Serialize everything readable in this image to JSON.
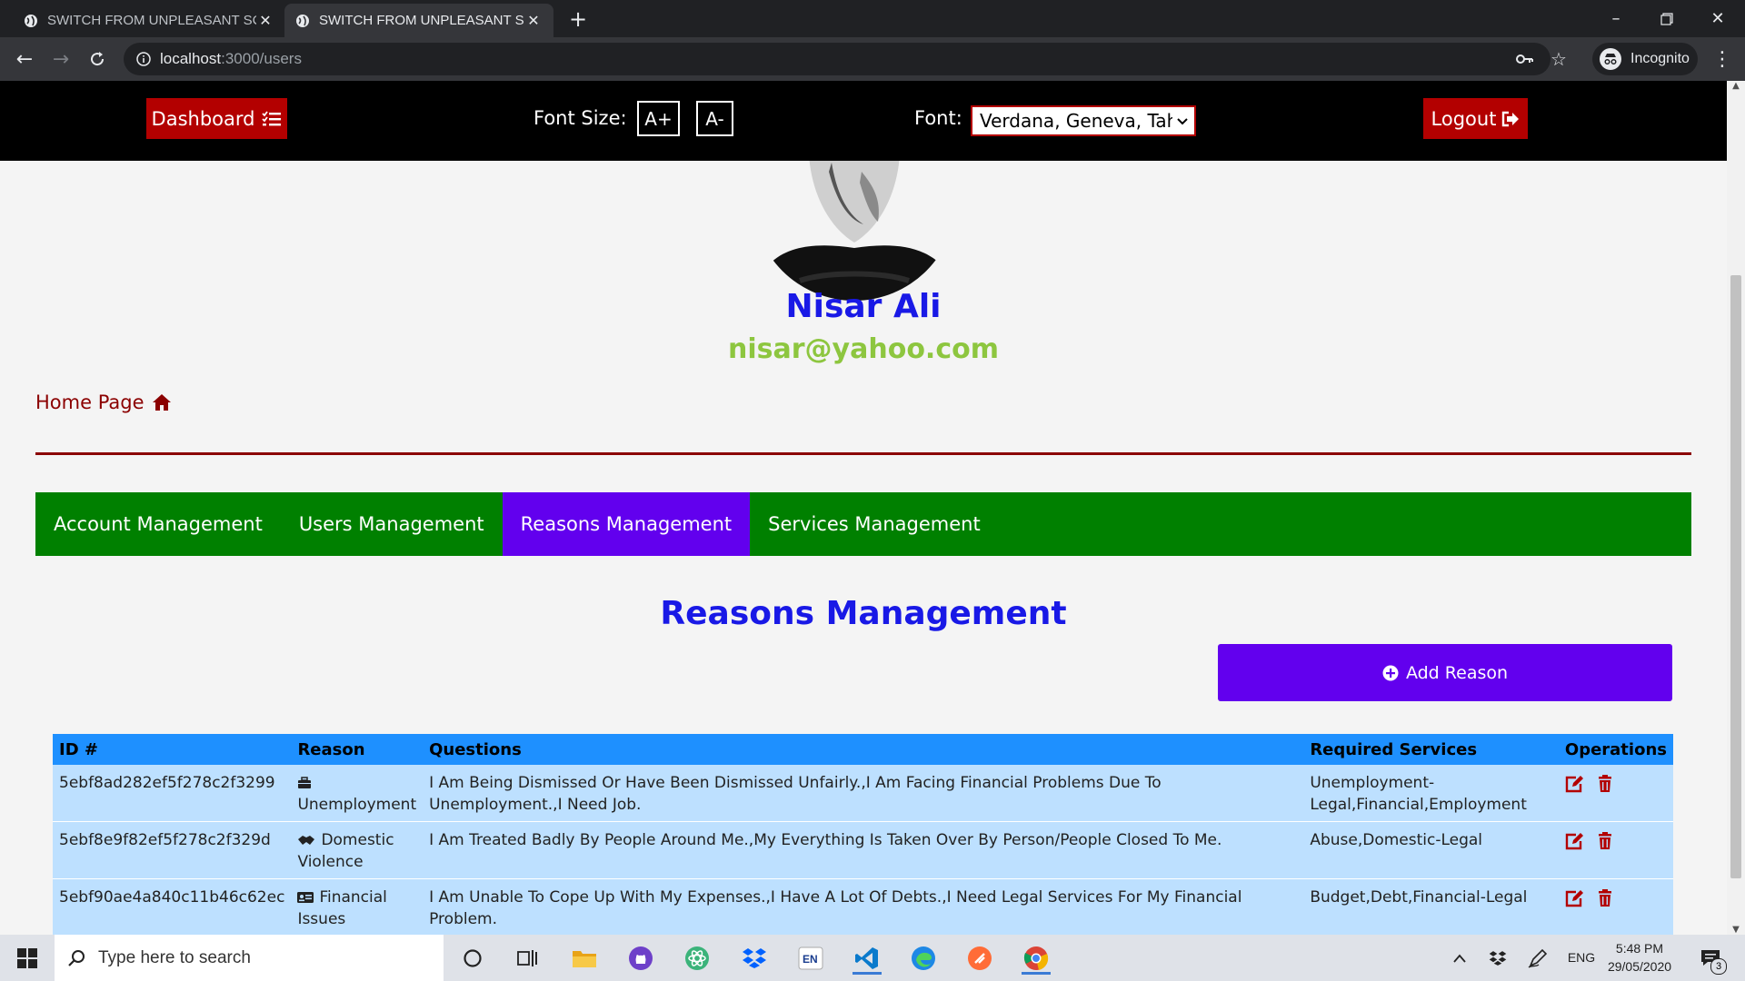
{
  "browser": {
    "tabs": [
      {
        "title": "SWITCH FROM UNPLEASANT SCENARIO",
        "active": false
      },
      {
        "title": "SWITCH FROM UNPLEASANT SCENARIO",
        "active": true
      }
    ],
    "url_host": "localhost",
    "url_path": ":3000/users",
    "profile_label": "Incognito"
  },
  "header": {
    "dashboard_label": "Dashboard",
    "font_size_label": "Font Size:",
    "increase_label": "A+",
    "decrease_label": "A-",
    "font_label": "Font:",
    "font_value": "Verdana, Geneva, Tahoma, sans-serif",
    "logout_label": "Logout"
  },
  "profile": {
    "name": "Nisar Ali",
    "email": "nisar@yahoo.com"
  },
  "home_link": "Home Page",
  "mgmt_nav": [
    {
      "label": "Account Management",
      "active": false
    },
    {
      "label": "Users Management",
      "active": false
    },
    {
      "label": "Reasons Management",
      "active": true
    },
    {
      "label": "Services Management",
      "active": false
    }
  ],
  "section_title": "Reasons Management",
  "add_button_label": "Add Reason",
  "table": {
    "columns": [
      "ID #",
      "Reason",
      "Questions",
      "Required Services",
      "Operations"
    ],
    "rows": [
      {
        "id": "5ebf8ad282ef5f278c2f3299",
        "reason": "Unemployment",
        "reason_icon": "briefcase-icon",
        "questions": "I Am Being Dismissed Or Have Been Dismissed Unfairly.,I Am Facing Financial Problems Due To Unemployment.,I Need Job.",
        "services": "Unemployment-Legal,Financial,Employment"
      },
      {
        "id": "5ebf8e9f82ef5f278c2f329d",
        "reason": "Domestic Violence",
        "reason_icon": "handshake-icon",
        "questions": "I Am Treated Badly By People Around Me.,My Everything Is Taken Over By Person/People Closed To Me.",
        "services": "Abuse,Domestic-Legal"
      },
      {
        "id": "5ebf90ae4a840c11b46c62ec",
        "reason": "Financial Issues",
        "reason_icon": "id-card-icon",
        "questions": "I Am Unable To Cope Up With My Expenses.,I Have A Lot Of Debts.,I Need Legal Services For My Financial Problem.",
        "services": "Budget,Debt,Financial-Legal"
      }
    ]
  },
  "taskbar": {
    "search_placeholder": "Type here to search",
    "language": "ENG",
    "time": "5:48 PM",
    "date": "29/05/2020",
    "notification_count": "3"
  },
  "colors": {
    "accent_red": "#b30000",
    "nav_green": "#008000",
    "purple": "#6200ee",
    "title_blue": "#1919e6",
    "email_green": "#8dc63f",
    "table_header": "#1e90ff",
    "table_row": "#bde0ff"
  }
}
